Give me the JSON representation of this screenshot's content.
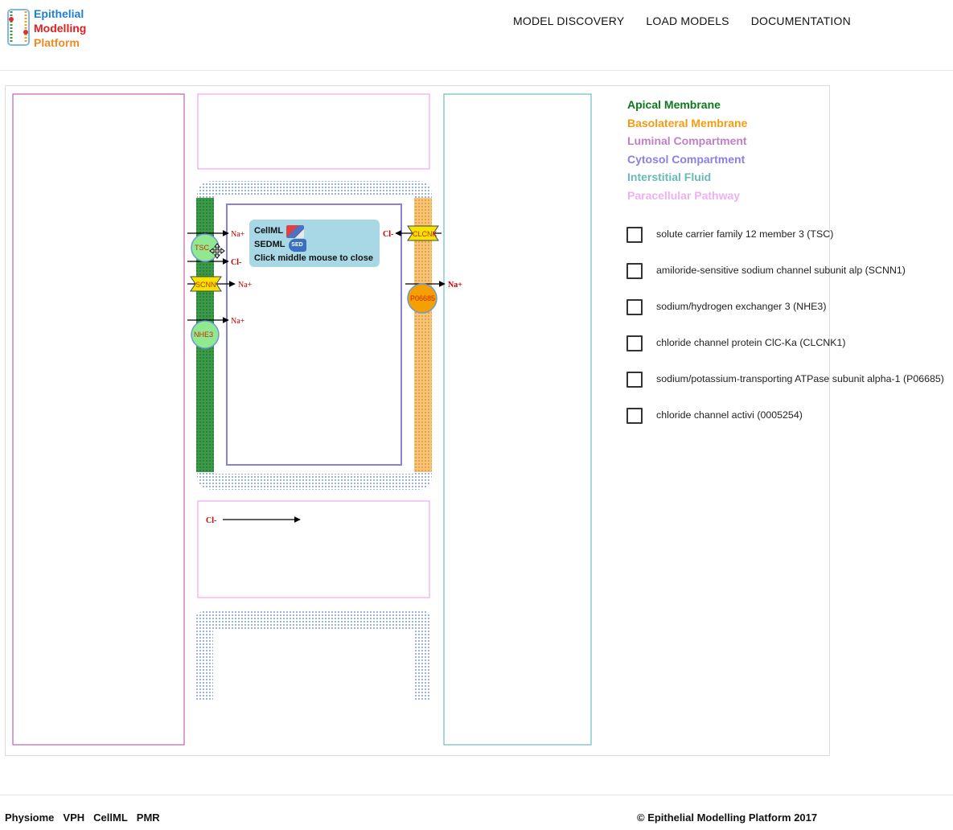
{
  "logo": {
    "line1": "Epithelial",
    "line2": "Modelling",
    "line3": "Platform"
  },
  "nav": [
    "MODEL DISCOVERY",
    "LOAD MODELS",
    "DOCUMENTATION"
  ],
  "diagram": {
    "labels": {
      "apical_na_1": "Na+",
      "apical_cl_1": "Cl-",
      "apical_na_2": "Na+",
      "apical_na_3": "Na+",
      "baso_cl": "Cl-",
      "baso_na": "Na+",
      "para_cl": "Cl-"
    },
    "transporters": {
      "tsc": "TSC",
      "scnn": "SCNN",
      "nhe3": "NHE3",
      "clcnk": "CLCNK",
      "p06685": "P06685"
    },
    "colors": {
      "apical": "#2e8b3c",
      "basolateral": "#f5a623",
      "luminal": "#c060b0",
      "cytosol": "#8a80d8",
      "interstitial": "#6abdbd",
      "paracellular": "#f0a8f0",
      "transport_label": "#cc0000",
      "tight_junction_dots": "#5a7fc0"
    }
  },
  "popup": {
    "cellml": "CellML",
    "sedml": "SEDML",
    "close_hint": "Click middle mouse to close"
  },
  "legend": [
    {
      "label": "Apical Membrane",
      "color": "#0a7a1a"
    },
    {
      "label": "Basolateral Membrane",
      "color": "#f39c12"
    },
    {
      "label": "Luminal Compartment",
      "color": "#c080c8"
    },
    {
      "label": "Cytosol Compartment",
      "color": "#8a80e0"
    },
    {
      "label": "Interstitial Fluid",
      "color": "#6ab8b8"
    },
    {
      "label": "Paracellular Pathway",
      "color": "#f0b0f0"
    }
  ],
  "checklist": [
    {
      "label": "solute carrier family 12 member 3 (TSC)",
      "checked": false
    },
    {
      "label": "amiloride-sensitive sodium channel subunit alp (SCNN1)",
      "checked": false
    },
    {
      "label": "sodium/hydrogen exchanger 3 (NHE3)",
      "checked": false
    },
    {
      "label": "chloride channel protein ClC-Ka (CLCNK1)",
      "checked": false
    },
    {
      "label": "sodium/potassium-transporting ATPase subunit alpha-1 (P06685)",
      "checked": false
    },
    {
      "label": "chloride channel activi (0005254)",
      "checked": false
    }
  ],
  "footer": {
    "links": [
      "Physiome",
      "VPH",
      "CellML",
      "PMR"
    ],
    "copyright": "© Epithelial Modelling Platform 2017"
  }
}
